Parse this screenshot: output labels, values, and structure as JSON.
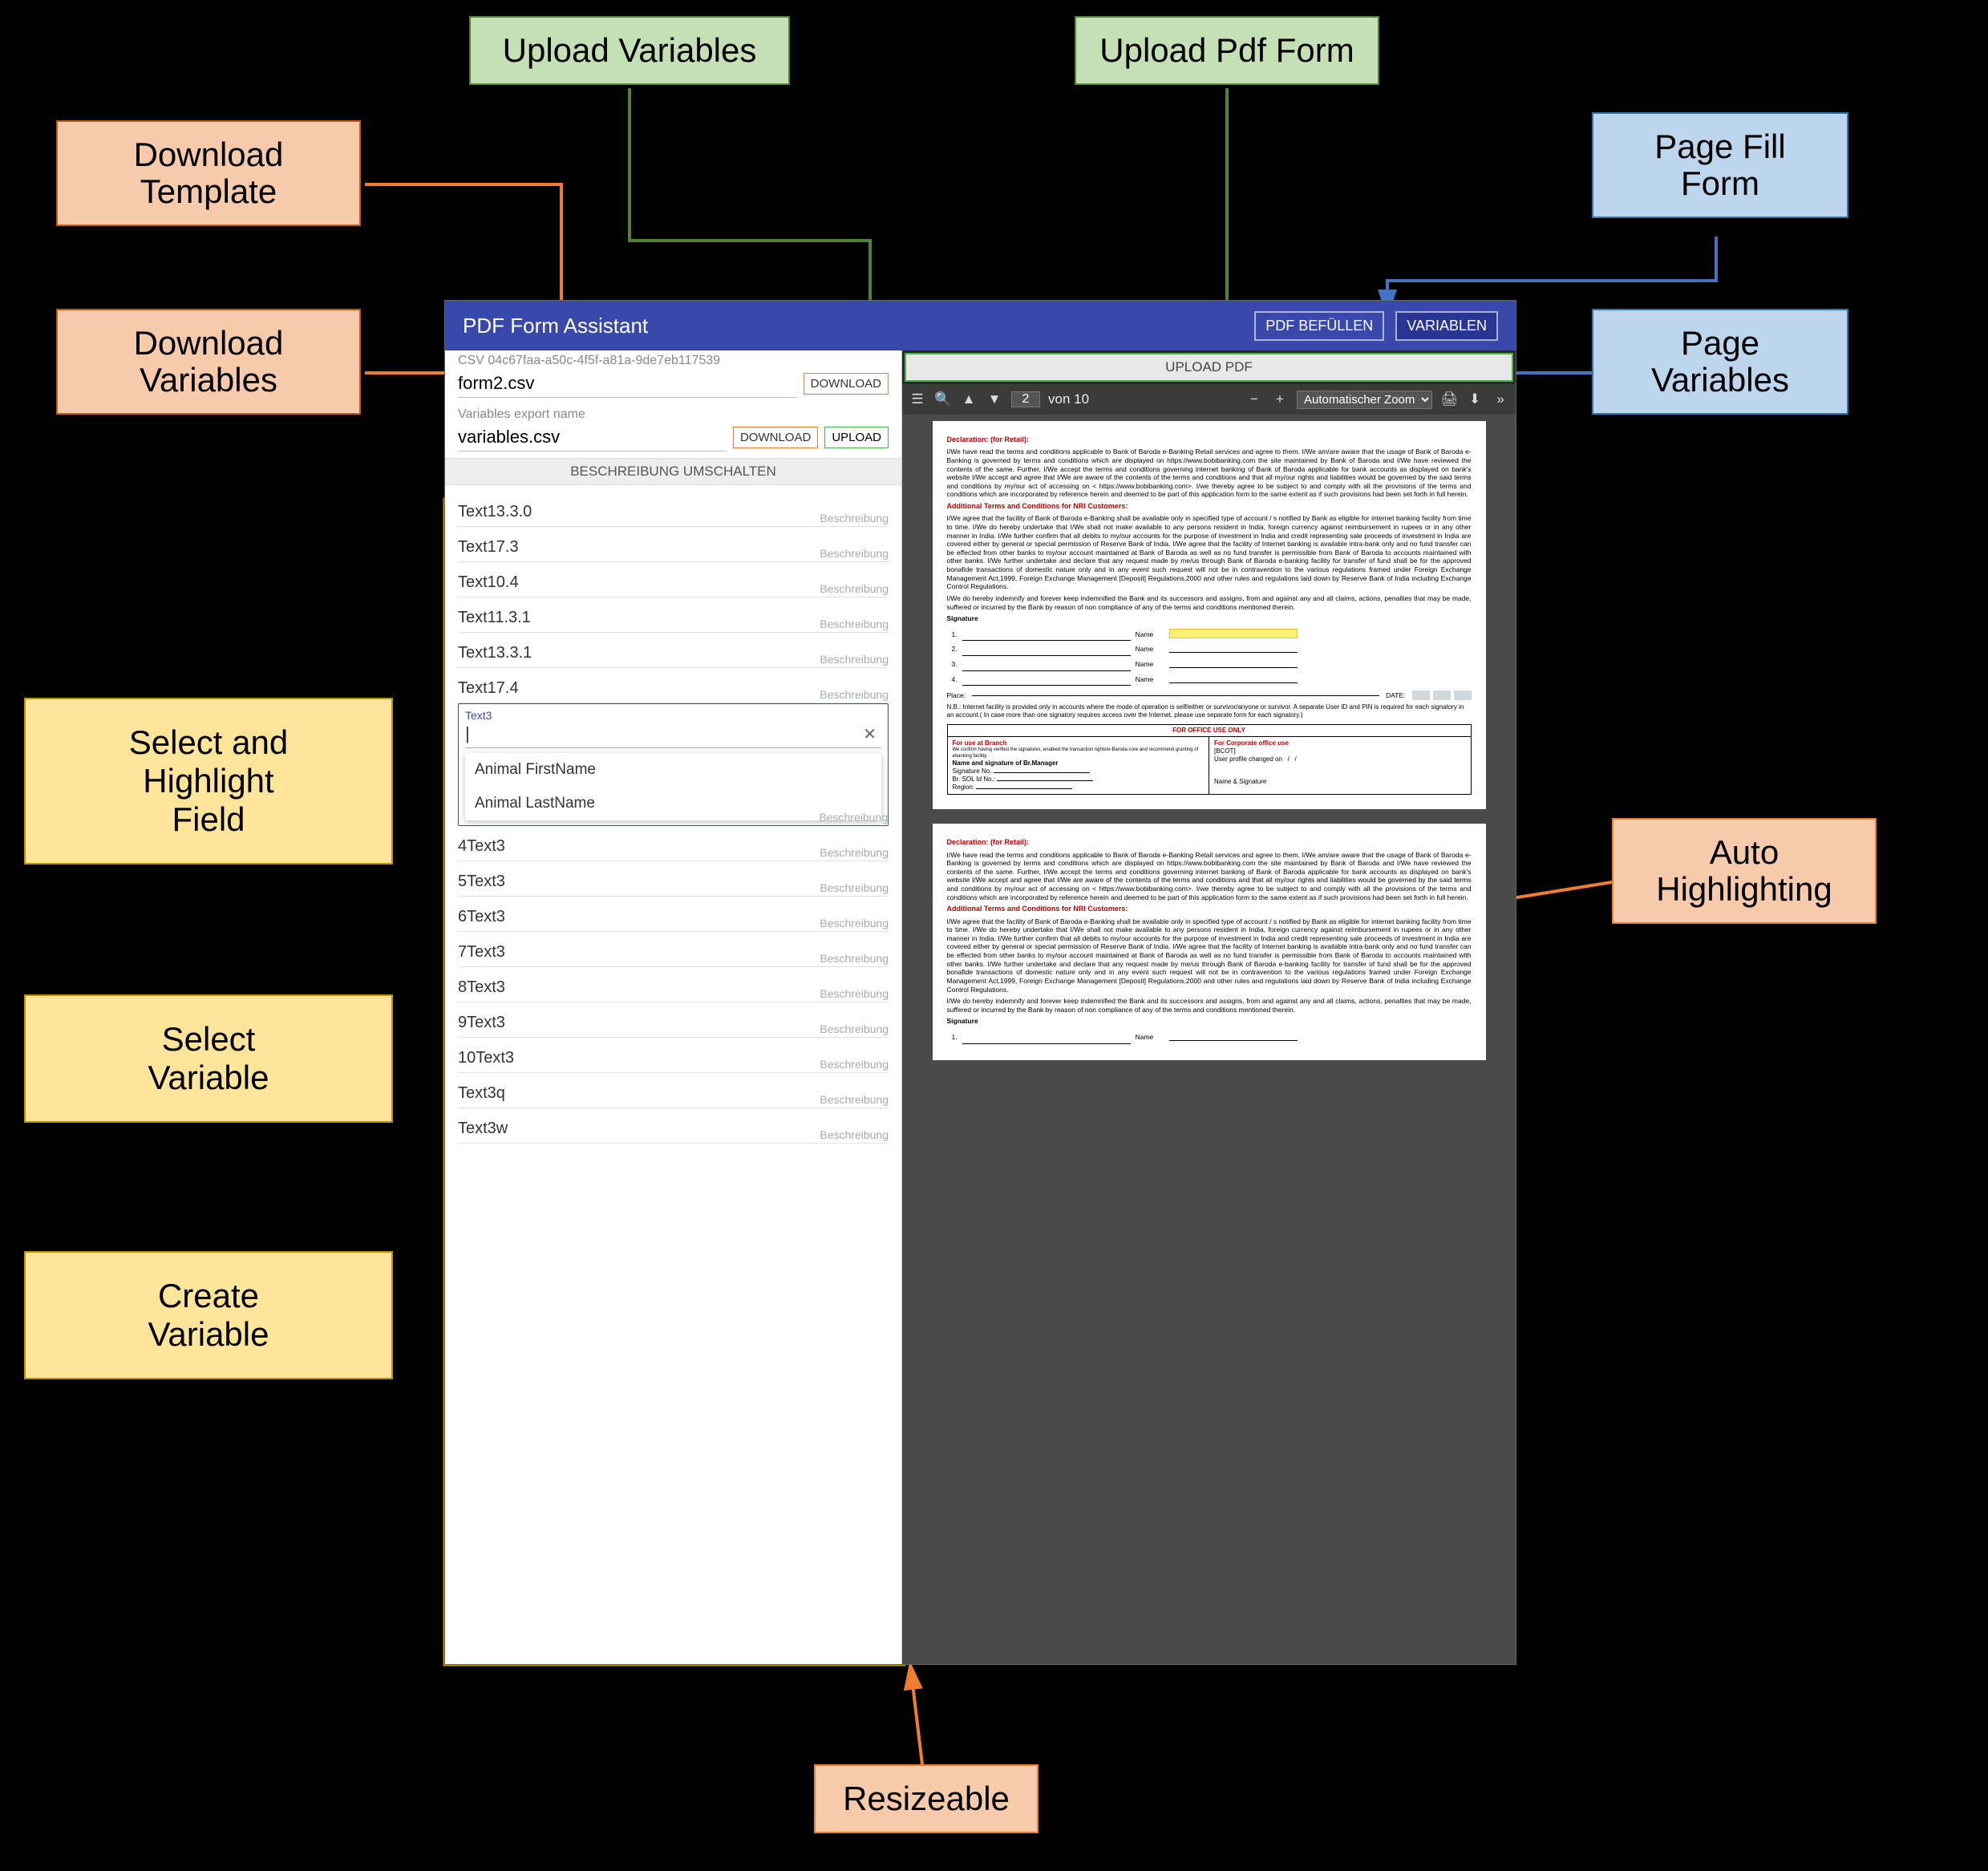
{
  "callouts": {
    "upload_variables": "Upload Variables",
    "upload_pdf_form": "Upload Pdf Form",
    "download_template": "Download\nTemplate",
    "download_variables": "Download\nVariables",
    "page_fill_form": "Page Fill\nForm",
    "page_variables": "Page\nVariables",
    "select_highlight_field": "Select and\nHighlight\nField",
    "select_variable": "Select\nVariable",
    "create_variable": "Create\nVariable",
    "auto_highlighting": "Auto\nHighlighting",
    "resizeable": "Resizeable"
  },
  "titlebar": {
    "title": "PDF Form Assistant",
    "btn_fill": "PDF BEFÜLLEN",
    "btn_vars": "VARIABLEN"
  },
  "left": {
    "csv_meta": "CSV 04c67faa-a50c-4f5f-a81a-9de7eb117539",
    "form_file": "form2.csv",
    "vars_meta": "Variables export name",
    "vars_file": "variables.csv",
    "btn_download": "DOWNLOAD",
    "btn_upload": "UPLOAD",
    "desc_toggle": "BESCHREIBUNG UMSCHALTEN",
    "desc_label": "Beschreibung",
    "fields": [
      "Text13.3.0",
      "Text17.3",
      "Text10.4",
      "Text11.3.1",
      "Text13.3.1",
      "Text17.4"
    ],
    "open_field": {
      "name": "Text3",
      "options": [
        "Animal FirstName",
        "Animal LastName"
      ]
    },
    "fields_after": [
      "4Text3",
      "5Text3",
      "6Text3",
      "7Text3",
      "8Text3",
      "9Text3",
      "10Text3",
      "Text3q",
      "Text3w"
    ]
  },
  "right": {
    "upload_label": "UPLOAD PDF",
    "toolbar": {
      "page_current": "2",
      "page_sep": "von",
      "page_total": "10",
      "zoom_label": "Automatischer Zoom"
    }
  },
  "pdf": {
    "decl_heading": "Declaration: (for Retail):",
    "decl_body": "I/We have read the terms and conditions applicable to Bank of Baroda e-Banking Retail services and agree to them. I/We am/are aware that the usage of Bank of Baroda e-Banking is governed by terms and conditions which are displayed on https://www.bobibanking.com the site maintained by Bank of Baroda and I/We have reviewed the contents of the same. Further, I/We accept the terms and conditions governing internet banking of Bank of Baroda applicable for bank accounts as displayed on bank's website I/We accept and agree that I/We are aware of the contents of the terms and conditions and that all my/our rights and liabilities would be governed by the said terms and conditions by my/our act of accessing on < https://www.bobibanking.com>. I/we thereby agree to be subject to and comply with all the provisions of the terms and conditions which are incorporated by reference herein and deemed to be part of this application form to the same extent as if such provisions had been set forth in full herein.",
    "addl_heading": "Additional Terms and Conditions for NRI Customers:",
    "addl_body": "I/We agree that the facility of Bank of Baroda e-Banking shall be available only in specified type of account / s notified by Bank as eligible for internet banking facility from time to time. I/We do hereby undertake that I/We shall not make available to any persons resident in India, foreign currency against reimbursement in rupees or in any other manner in India. I/We further confirm that all debits to my/our accounts for the purpose of investment in India and credit representing sale proceeds of investment in India are covered either by general or special permission of Reserve Bank of India. I/We agree that the facility of Internet banking is available intra-bank only and no fund transfer can be effected from other banks to my/our account maintained at Bank of Baroda as well as no fund transfer is permissible from Bank of Baroda to accounts maintained with other banks. I/We further undertake and declare that any request made by me/us through Bank of Baroda e-banking facility for transfer of fund shall be for the approved bonafide transactions of domestic nature only and in any event such request will not be in contravention to the various regulations framed under Foreign Exchange Management Act,1999, Foreign Exchange Management [Deposit] Regulations,2000 and other rules and regulations laid down by Reserve Bank of India including Exchange Control Regulations.",
    "indemnify": "I/We do hereby indemnify and forever keep indemnified the Bank and its successors and assigns, from and against any and all claims, actions, penalties that may be made, suffered or incurred by the Bank by reason of non compliance of any of the terms and conditions mentioned therein.",
    "signature_label": "Signature",
    "name_label": "Name",
    "place_label": "Place:",
    "date_label": "DATE:",
    "nb": "N.B.: Internet facility is provided only in accounts where the mode of operation is self/either or survivor/anyone or survivor. A separate User ID and PIN is required for each signatory in an account.( In case more than one signatory requires access over the Internet, please use separate form for each signatory.)",
    "office": {
      "header": "FOR OFFICE USE ONLY",
      "branch_hdr": "For use at Branch",
      "branch_line1": "We confirm having verified the signatures, enabled the transaction rights/e-Baroda core and recommend granting of ebanking facility.",
      "mgr": "Name and signature of Br.Manager",
      "signo": "Signature No.",
      "brsol": "Br. SOL Id No.:",
      "region": "Region:",
      "corp_hdr": "For Corporate office use",
      "bcot": "[BCOT]",
      "profile": "User profile changed on",
      "namesig": "Name & Signature"
    }
  }
}
